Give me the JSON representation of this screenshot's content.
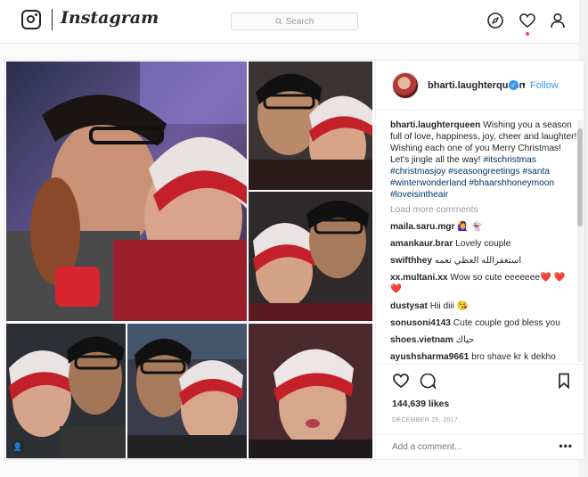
{
  "app": {
    "wordmark": "Instagram",
    "search_placeholder": "Search",
    "icons": [
      "instagram-camera-icon",
      "compass-icon",
      "heart-icon",
      "profile-icon"
    ]
  },
  "post": {
    "username": "bharti.laughterqueen",
    "follow_separator": "•",
    "follow_label": "Follow",
    "caption": {
      "username": "bharti.laughterqueen",
      "text": "Wishing you a season full of love, happiness, joy, cheer and laughter! Wishing each one of you Merry Christmas! Let's jingle all the way!",
      "hashtags": [
        "#itschristmas",
        "#christmasjoy",
        "#seasongreetings",
        "#santa",
        "#winterwonderland",
        "#bhaarshhoneymoon",
        "#loveisintheair"
      ]
    },
    "load_more": "Load more comments",
    "comments": [
      {
        "user": "maila.saru.mgr",
        "text": "🙋‍♀️ 👻"
      },
      {
        "user": "amankaur.brar",
        "text": "Lovely couple"
      },
      {
        "user": "swifthhey",
        "text": "استغفرالله العظي نعمه"
      },
      {
        "user": "xx.multani.xx",
        "text": "Wow so cute eeeeeee❤️ ❤️ ❤️"
      },
      {
        "user": "dustysat",
        "text": "Hii diii 😘"
      },
      {
        "user": "sonusoni4143",
        "text": "Cute couple god bless you"
      },
      {
        "user": "shoes.vietnam",
        "text": "حياك"
      },
      {
        "user": "ayushsharma9661",
        "text": "bro shave kr k dekho"
      }
    ],
    "likes": "144,639 likes",
    "date": "DECEMBER 25, 2017",
    "add_comment_placeholder": "Add a comment...",
    "more_options": "•••",
    "tag_badge": "👤"
  },
  "colors": {
    "link_blue": "#3897f0",
    "hashtag": "#003569",
    "muted": "#999999",
    "notification": "#ed4956"
  }
}
